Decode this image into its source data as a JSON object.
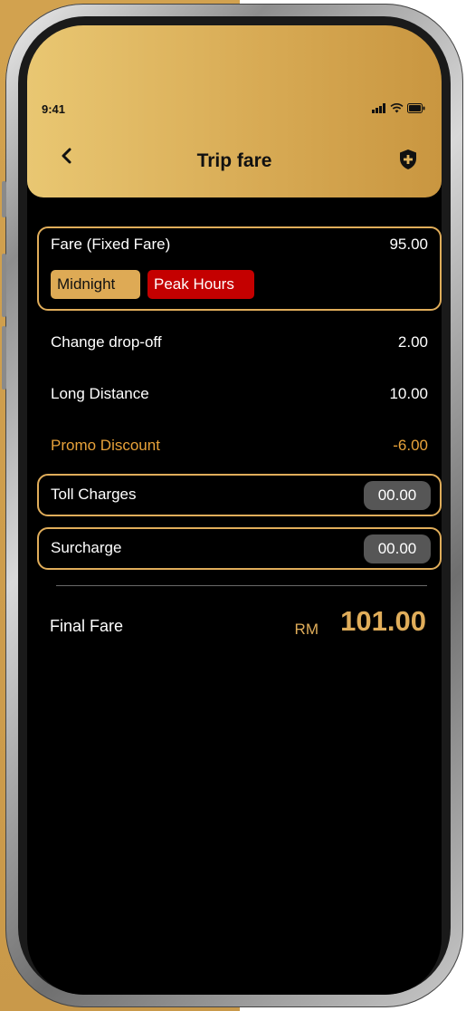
{
  "status_bar": {
    "time": "9:41"
  },
  "header": {
    "title": "Trip fare"
  },
  "fare_rows": {
    "fare": {
      "label": "Fare (Fixed Fare)",
      "value": "95.00"
    },
    "tags": {
      "midnight": "Midnight",
      "peak": "Peak Hours"
    },
    "change_dropoff": {
      "label": "Change drop-off",
      "value": "2.00"
    },
    "long_distance": {
      "label": "Long Distance",
      "value": "10.00"
    },
    "promo": {
      "label": "Promo Discount",
      "value": "-6.00"
    },
    "toll": {
      "label": "Toll Charges",
      "value": "00.00"
    },
    "surcharge": {
      "label": "Surcharge",
      "value": "00.00"
    }
  },
  "final": {
    "label": "Final Fare",
    "currency": "RM",
    "amount": "101.00"
  },
  "colors": {
    "accent": "#E0AD5A",
    "peak_red": "#C40000",
    "promo_orange": "#E8A23A",
    "background": "#000000"
  },
  "icons": {
    "back": "chevron-left-icon",
    "shield": "shield-plus-icon",
    "signal": "signal-icon",
    "wifi": "wifi-icon",
    "battery": "battery-icon"
  }
}
